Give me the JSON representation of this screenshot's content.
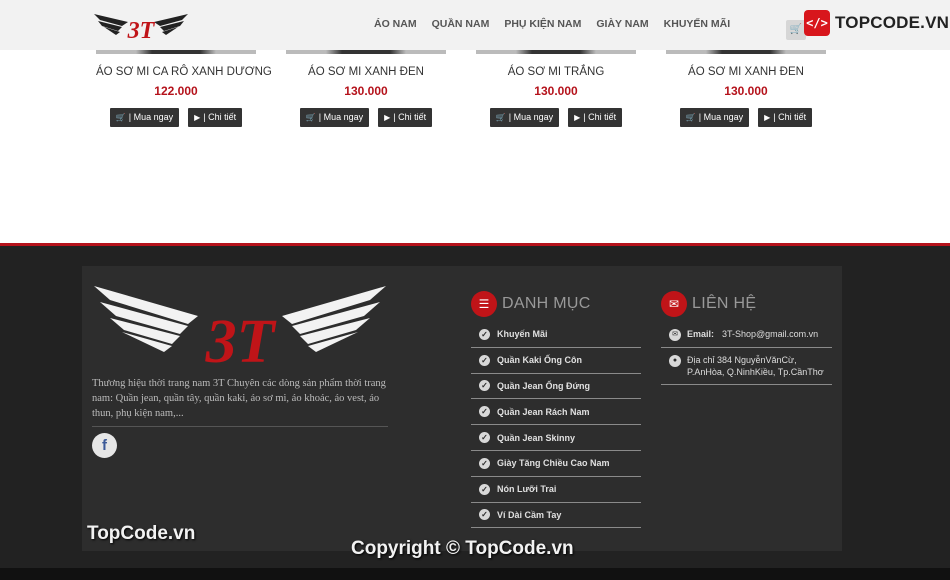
{
  "header": {
    "logo_text": "3T",
    "nav": [
      "ÁO NAM",
      "QUẦN NAM",
      "PHỤ KIỆN NAM",
      "GIÀY NAM",
      "KHUYẾN MÃI"
    ],
    "cart_icon": "cart-icon"
  },
  "watermark": {
    "top_icon": "</>",
    "top_text": "TOPCODE.VN",
    "bottom_left": "TopCode.vn",
    "bottom_center": "Copyright © TopCode.vn"
  },
  "products": [
    {
      "name": "ÁO SƠ MI CA RÔ XANH DƯƠNG",
      "price": "122.000",
      "buy_label": "| Mua ngay",
      "detail_label": "| Chi tiết"
    },
    {
      "name": "ÁO SƠ MI XANH ĐEN",
      "price": "130.000",
      "buy_label": "| Mua ngay",
      "detail_label": "| Chi tiết"
    },
    {
      "name": "ÁO SƠ MI TRẮNG",
      "price": "130.000",
      "buy_label": "| Mua ngay",
      "detail_label": "| Chi tiết"
    },
    {
      "name": "ÁO SƠ MI XANH ĐEN",
      "price": "130.000",
      "buy_label": "| Mua ngay",
      "detail_label": "| Chi tiết"
    }
  ],
  "footer": {
    "brand_logo_text": "3T",
    "description": "Thương hiệu thời trang nam 3T Chuyên các dòng sản phẩm thời trang nam: Quần jean, quần tây, quần kaki, áo sơ mi, áo khoác, áo vest, áo thun, phụ kiện nam,...",
    "facebook_icon": "f",
    "category_title": "DANH MỤC",
    "categories": [
      "Khuyến Mãi",
      "Quần Kaki Ống Côn",
      "Quần Jean Ống Đứng",
      "Quần Jean Rách Nam",
      "Quần Jean Skinny",
      "Giày Tăng Chiều Cao Nam",
      "Nón Lưỡi Trai",
      "Ví Dài Cầm Tay"
    ],
    "contact_title": "LIÊN HỆ",
    "contact": {
      "email_label": "Email:",
      "email": "3T-Shop@gmail.com.vn",
      "address": "Địa chỉ 384 NguyễnVănCừ, P.AnHòa, Q.NinhKiều, Tp.CầnThơ"
    }
  },
  "colors": {
    "accent": "#b5121b",
    "footer_bg": "#222222",
    "panel_bg": "#2d2d2d",
    "header_bg": "#f2f2f2"
  }
}
